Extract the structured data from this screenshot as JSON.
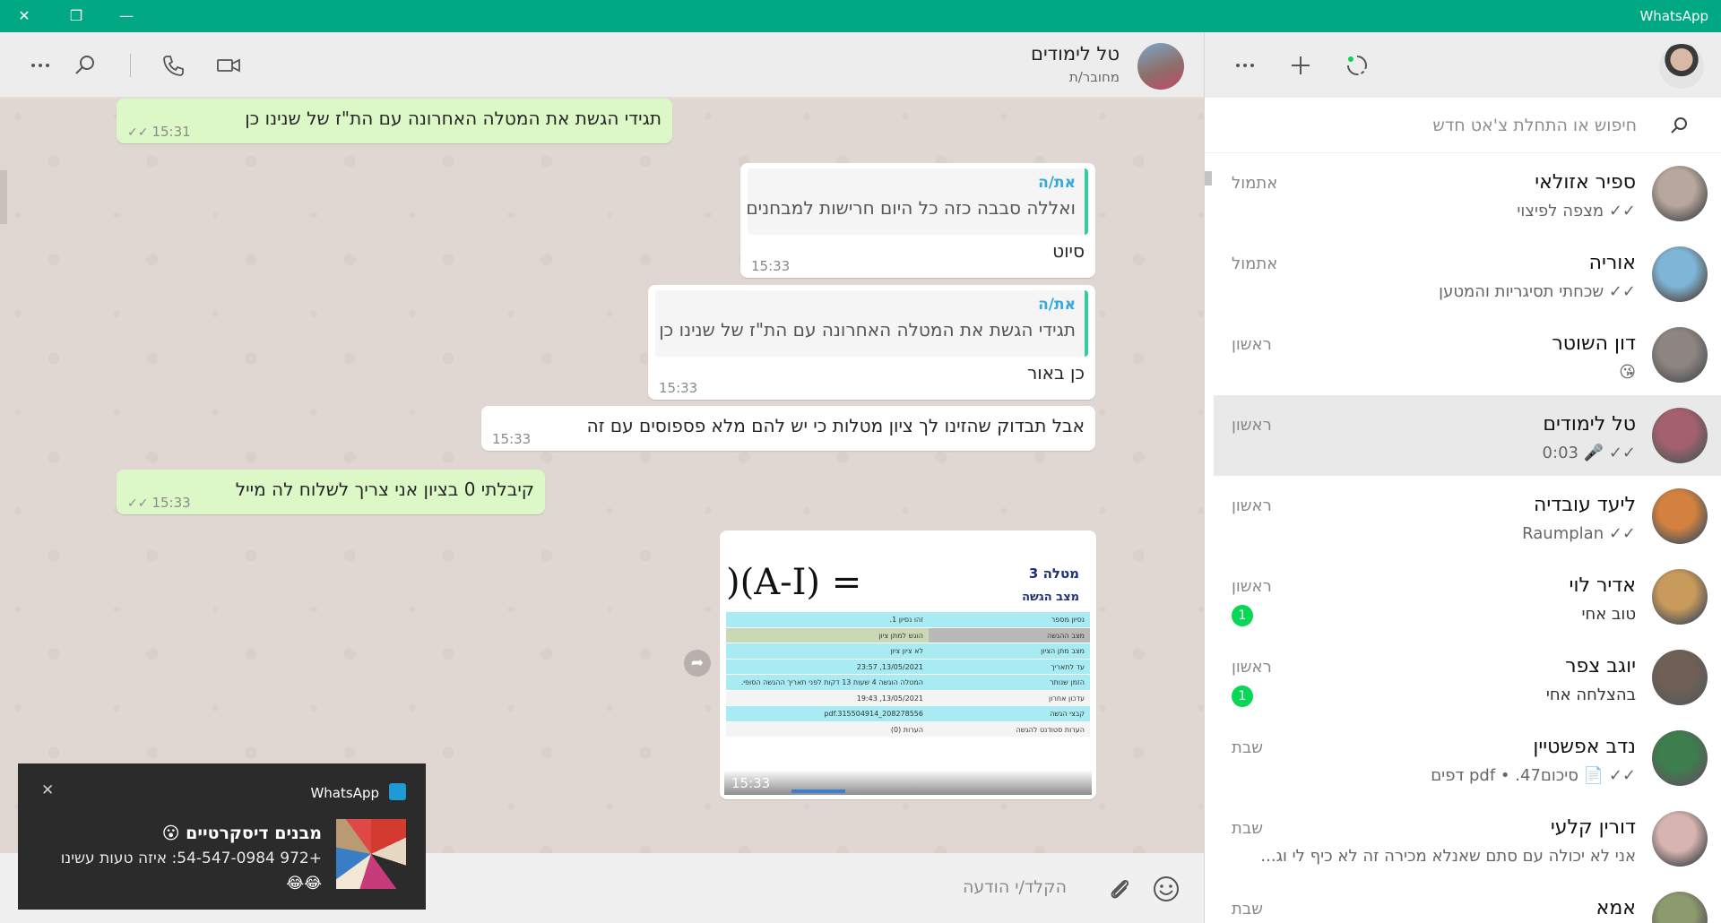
{
  "window": {
    "title": "WhatsApp"
  },
  "chat_header": {
    "name": "טל לימודים",
    "status": "מחובר/ת"
  },
  "messages": [
    {
      "type": "out",
      "text": "תגידי הגשת את המטלה האחרונה עם הת\"ז של שנינו כן",
      "time": "15:31"
    },
    {
      "type": "in",
      "quote_author": "את/ה",
      "quote_text": "ואללה סבבה כזה כל היום חרישות למבחנים",
      "text": "סיוט",
      "time": "15:33"
    },
    {
      "type": "in",
      "quote_author": "את/ה",
      "quote_text": "תגידי הגשת את המטלה האחרונה  עם הת\"ז של שנינו כן",
      "text": "כן באור",
      "time": "15:33"
    },
    {
      "type": "in",
      "text": "אבל תבדוק שהזינו לך ציון מטלות כי יש להם מלא פספוסים עם זה",
      "time": "15:33"
    },
    {
      "type": "out",
      "text": "קיבלתי 0 בציון אני צריך לשלוח לה מייל",
      "time": "15:33"
    }
  ],
  "image_message": {
    "time": "15:33",
    "doc_title": "מטלה 3",
    "doc_subtitle": "מצב הגשה",
    "handwriting": ")(A-I) =",
    "rows": [
      {
        "k": "נסיון מספר",
        "v": "זהו נסיון 1."
      },
      {
        "k": "מצב ההגשה",
        "v": "הוגש למתן ציון"
      },
      {
        "k": "מצב מתן הציון",
        "v": "לא ציון ציון"
      },
      {
        "k": "עד לתאריך",
        "v": "13/05/2021, 23:57"
      },
      {
        "k": "הזמן שנותר",
        "v": "המטלה הוגשה 4 שעות 13 דקות לפני תאריך ההגשה הסופי."
      },
      {
        "k": "עדכון אחרון",
        "v": "13/05/2021, 19:43"
      },
      {
        "k": "קבצי הגשה",
        "v": "pdf.315504914_208278556"
      },
      {
        "k": "הערות סטודנט להגשה",
        "v": "הערות (0)"
      }
    ]
  },
  "composer": {
    "placeholder": "הקלד/י הודעה"
  },
  "toast": {
    "app": "WhatsApp",
    "title": "מבנים דיסקרטיים 😮",
    "body": "+972 54-547-0984: איזה טעות עשינו",
    "emoji": "😂😂"
  },
  "sidebar": {
    "search_placeholder": "חיפוש או התחלת צ'אט חדש",
    "chats": [
      {
        "name": "ספיר אזולאי",
        "preview": "✓✓ מצפה לפיצוי",
        "time": "אתמול",
        "badge": "",
        "color": "#b8a79c"
      },
      {
        "name": "אוריה",
        "preview": "✓✓ שכחתי תסיגריות והמטען",
        "time": "אתמול",
        "badge": "",
        "color": "#7fb5d6"
      },
      {
        "name": "דון השוטר",
        "preview": "😘",
        "time": "ראשון",
        "badge": "",
        "color": "#8c8582"
      },
      {
        "name": "טל לימודים",
        "preview": "✓✓ 🎤 0:03",
        "time": "ראשון",
        "badge": "",
        "color": "#a4606e"
      },
      {
        "name": "ליעד עובדיה",
        "preview": "✓✓ Raumplan",
        "time": "ראשון",
        "badge": "",
        "color": "#d2813e"
      },
      {
        "name": "אדיר לוי",
        "preview": "טוב אחי",
        "time": "ראשון",
        "badge": "1",
        "color": "#c89a5b"
      },
      {
        "name": "יוגב צפר",
        "preview": "בהצלחה אחי",
        "time": "ראשון",
        "badge": "1",
        "color": "#6f5f55"
      },
      {
        "name": "נדב אפשטיין",
        "preview": "✓✓ 📄 סיכום47. • pdf דפים",
        "time": "שבת",
        "badge": "",
        "color": "#3e7d4e"
      },
      {
        "name": "דורין קלעי",
        "preview": "אני לא יכולה עם סתם שאנלא מכירה זה לא כיף לי וג...",
        "time": "שבת",
        "badge": "",
        "color": "#d8b4b1"
      },
      {
        "name": "אמא",
        "preview": "",
        "time": "שבת",
        "badge": "",
        "color": "#8c9a6e"
      }
    ]
  }
}
